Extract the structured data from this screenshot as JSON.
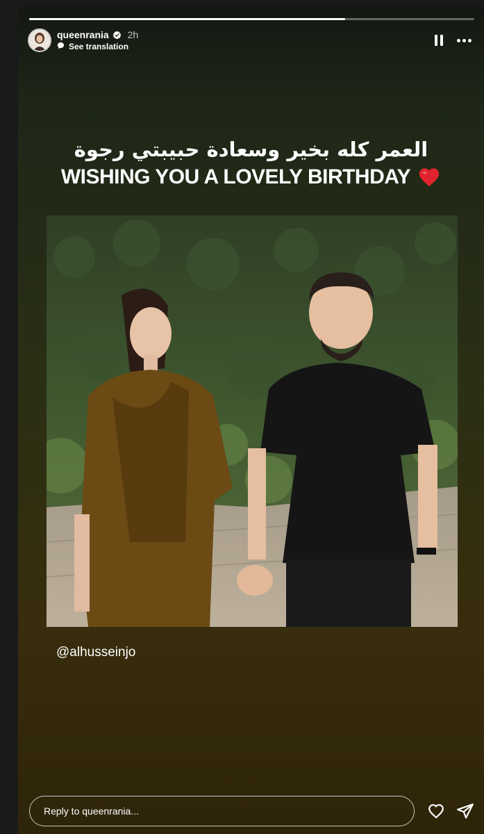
{
  "story": {
    "progress": 0.71,
    "account": {
      "username": "queenrania",
      "verified": true,
      "time_ago": "2h",
      "see_translation": "See translation"
    },
    "caption": {
      "arabic": "العمر كله بخير وسعادة حبيبتي رجوة",
      "english": "WISHING YOU A LOVELY BIRTHDAY"
    },
    "mention": "@alhusseinjo",
    "reply": {
      "placeholder": "Reply to queenrania..."
    }
  },
  "icons": {
    "verified": "verified-badge-icon",
    "translation": "speech-bubble-icon",
    "pause": "pause-icon",
    "more": "more-options-icon",
    "heart_emoji": "red-heart-emoji",
    "like": "heart-outline-icon",
    "share": "send-icon"
  },
  "colors": {
    "accent_red": "#e0242f",
    "verified_blue": "#ffffff"
  }
}
